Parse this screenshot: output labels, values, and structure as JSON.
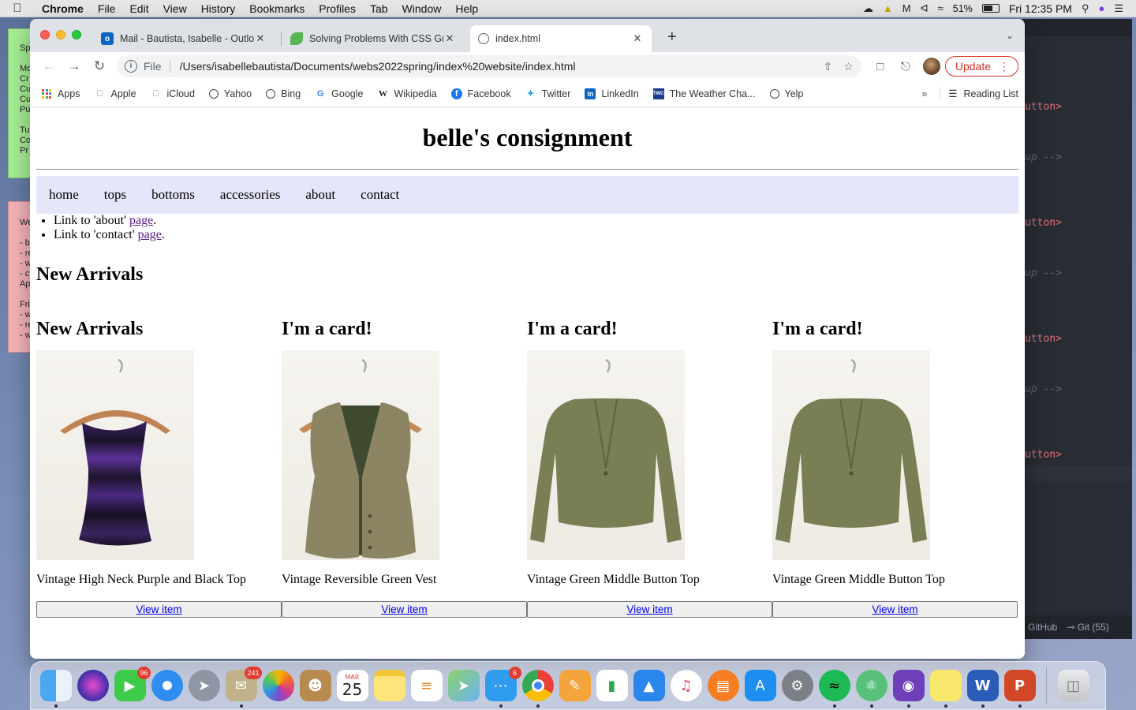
{
  "menubar": {
    "app_name": "Chrome",
    "items": [
      "File",
      "Edit",
      "View",
      "History",
      "Bookmarks",
      "Profiles",
      "Tab",
      "Window",
      "Help"
    ],
    "battery": "51%",
    "clock": "Fri 12:35 PM"
  },
  "desktop": {
    "sticky_green_lines": [
      "Sp",
      "",
      "Mo",
      "Cr",
      "Cu",
      "Cu",
      "Pu",
      "",
      "Tu",
      "Co",
      "Pr"
    ],
    "sticky_pink_lines": [
      "We",
      "",
      "- b",
      "- re",
      "- w",
      "- c",
      "Ap",
      "",
      "Fri",
      "- w",
      "- re",
      "- w"
    ],
    "editor_lines": [
      "utton>",
      "up -->",
      "utton>",
      "up -->",
      "utton>",
      "up -->",
      "utton>"
    ],
    "editor_status": {
      "github": "GitHub",
      "git": "Git (55)"
    }
  },
  "browser": {
    "tabs": [
      {
        "title": "Mail - Bautista, Isabelle - Outlo",
        "icon": "outlook-icon",
        "active": false
      },
      {
        "title": "Solving Problems With CSS Gri",
        "icon": "leaf-icon",
        "active": false
      },
      {
        "title": "index.html",
        "icon": "globe-icon",
        "active": true
      }
    ],
    "address": {
      "scheme": "File",
      "url": "/Users/isabellebautista/Documents/webs2022spring/index%20website/index.html"
    },
    "update_label": "Update",
    "bookmarks": [
      {
        "label": "Apps",
        "icon": "apps-grid-icon"
      },
      {
        "label": "Apple",
        "icon": "apple-icon"
      },
      {
        "label": "iCloud",
        "icon": "apple-icon"
      },
      {
        "label": "Yahoo",
        "icon": "globe-icon"
      },
      {
        "label": "Bing",
        "icon": "globe-icon"
      },
      {
        "label": "Google",
        "icon": "google-icon"
      },
      {
        "label": "Wikipedia",
        "icon": "wikipedia-icon"
      },
      {
        "label": "Facebook",
        "icon": "facebook-icon"
      },
      {
        "label": "Twitter",
        "icon": "twitter-icon"
      },
      {
        "label": "LinkedIn",
        "icon": "linkedin-icon"
      },
      {
        "label": "The Weather Cha...",
        "icon": "weather-channel-icon"
      },
      {
        "label": "Yelp",
        "icon": "globe-icon"
      }
    ],
    "reading_list": "Reading List"
  },
  "page": {
    "site_title": "belle's consignment",
    "nav": [
      "home",
      "tops",
      "bottoms",
      "accessories",
      "about",
      "contact"
    ],
    "links": [
      {
        "prefix": "Link to 'about' ",
        "link_text": "page",
        "suffix": "."
      },
      {
        "prefix": "Link to 'contact' ",
        "link_text": "page",
        "suffix": "."
      }
    ],
    "section_heading": "New Arrivals",
    "cards": [
      {
        "heading": "New Arrivals",
        "description": "Vintage High Neck Purple and Black Top",
        "button": "View item",
        "garment": "purple-top"
      },
      {
        "heading": "I'm a card!",
        "description": "Vintage Reversible Green Vest",
        "button": "View item",
        "garment": "vest"
      },
      {
        "heading": "I'm a card!",
        "description": "Vintage Green Middle Button Top",
        "button": "View item",
        "garment": "cardigan"
      },
      {
        "heading": "I'm a card!",
        "description": "Vintage Green Middle Button Top",
        "button": "View item",
        "garment": "cardigan"
      }
    ]
  },
  "dock": {
    "apps": [
      {
        "name": "finder",
        "badge": ""
      },
      {
        "name": "siri",
        "badge": ""
      },
      {
        "name": "facetime",
        "badge": "96"
      },
      {
        "name": "safari",
        "badge": ""
      },
      {
        "name": "launchpad",
        "badge": ""
      },
      {
        "name": "mail-stamp",
        "badge": "241"
      },
      {
        "name": "photos",
        "badge": ""
      },
      {
        "name": "contacts",
        "badge": ""
      },
      {
        "name": "calendar",
        "badge": ""
      },
      {
        "name": "notes",
        "badge": ""
      },
      {
        "name": "reminders",
        "badge": ""
      },
      {
        "name": "maps",
        "badge": ""
      },
      {
        "name": "messages",
        "badge": "6"
      },
      {
        "name": "chrome",
        "badge": ""
      },
      {
        "name": "pages",
        "badge": ""
      },
      {
        "name": "numbers",
        "badge": ""
      },
      {
        "name": "keynote",
        "badge": ""
      },
      {
        "name": "music",
        "badge": ""
      },
      {
        "name": "books",
        "badge": ""
      },
      {
        "name": "app-store",
        "badge": ""
      },
      {
        "name": "system-preferences",
        "badge": ""
      },
      {
        "name": "spotify",
        "badge": ""
      },
      {
        "name": "atom",
        "badge": ""
      },
      {
        "name": "github-desktop",
        "badge": ""
      },
      {
        "name": "stickies",
        "badge": ""
      },
      {
        "name": "word",
        "badge": ""
      },
      {
        "name": "powerpoint",
        "badge": ""
      },
      {
        "name": "trash",
        "badge": ""
      }
    ],
    "calendar_month": "MAR",
    "calendar_day": "25"
  }
}
